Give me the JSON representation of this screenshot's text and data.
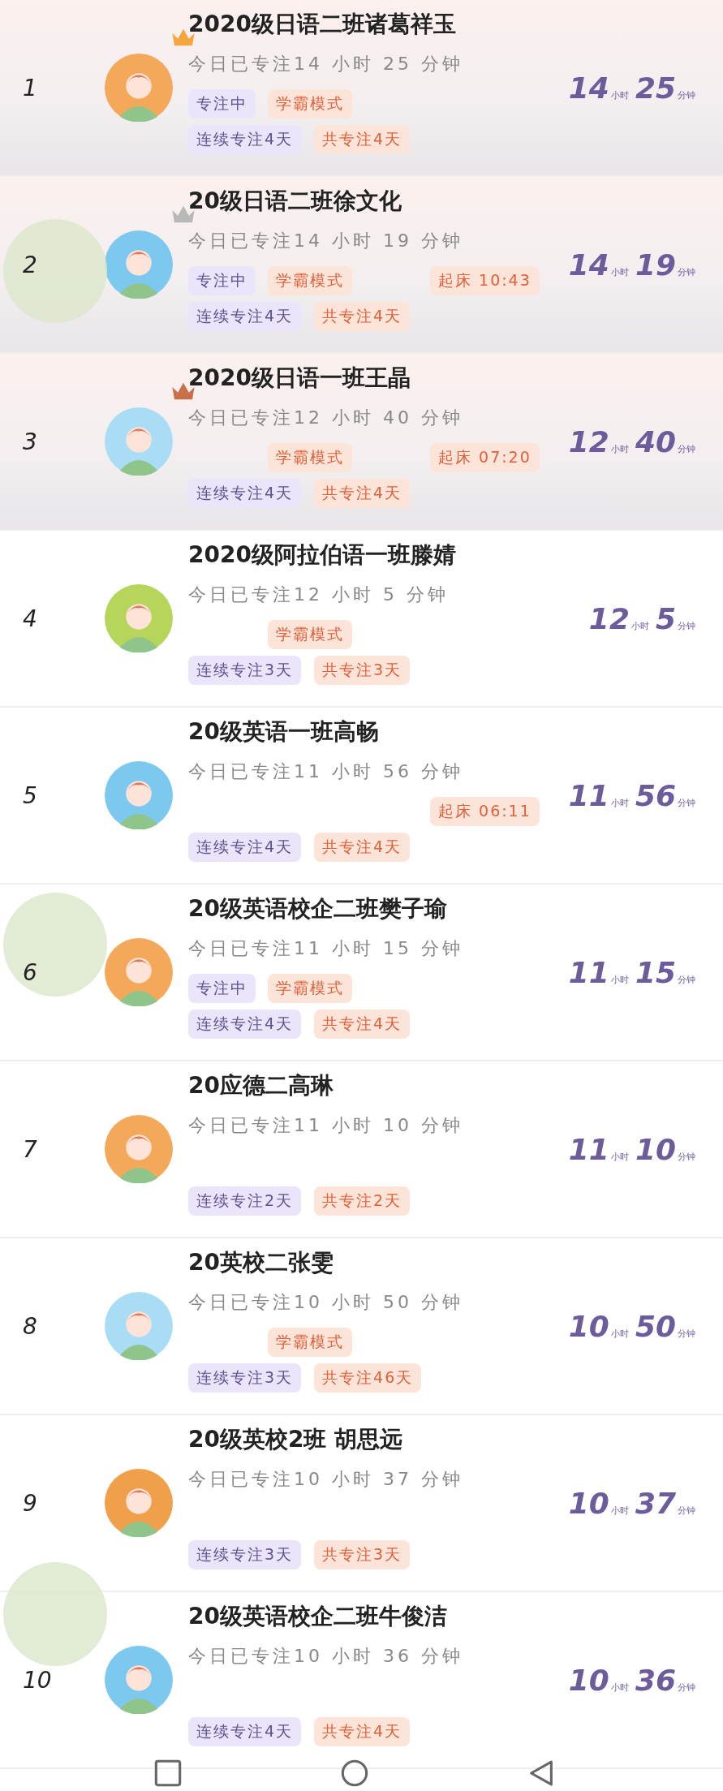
{
  "ranking": [
    {
      "rank": "1",
      "name": "2020级日语二班诸葛祥玉",
      "today": "今日已专注14 小时 25 分钟",
      "focusing": "专注中",
      "mode": "学霸模式",
      "streak": "连续专注4天",
      "total": "共专注4天",
      "hours": "14",
      "hours_unit": "小时",
      "minutes": "25",
      "minutes_unit": "分钟",
      "avatar": {
        "color": "#f4a85a"
      },
      "crown": {
        "color": "#f4a640"
      },
      "banner": true
    },
    {
      "rank": "2",
      "name": "20级日语二班徐文化",
      "today": "今日已专注14 小时 19 分钟",
      "focusing": "专注中",
      "mode": "学霸模式",
      "wake_up": "起床 10:43",
      "streak": "连续专注4天",
      "total": "共专注4天",
      "hours": "14",
      "hours_unit": "小时",
      "minutes": "19",
      "minutes_unit": "分钟",
      "avatar": {
        "color": "#7cc8ef"
      },
      "crown": {
        "color": "#b8b8b8"
      },
      "banner": true
    },
    {
      "rank": "3",
      "name": "2020级日语一班王晶",
      "today": "今日已专注12 小时 40 分钟",
      "mode": "学霸模式",
      "wake_up": "起床 07:20",
      "streak": "连续专注4天",
      "total": "共专注4天",
      "hours": "12",
      "hours_unit": "小时",
      "minutes": "40",
      "minutes_unit": "分钟",
      "avatar": {
        "color": "#a9dcf5"
      },
      "crown": {
        "color": "#c8704a"
      },
      "banner": true
    },
    {
      "rank": "4",
      "name": "2020级阿拉伯语一班滕婧",
      "today": "今日已专注12 小时 5 分钟",
      "mode": "学霸模式",
      "streak": "连续专注3天",
      "total": "共专注3天",
      "hours": "12",
      "hours_unit": "小时",
      "minutes": "5",
      "minutes_unit": "分钟",
      "avatar": {
        "color": "#b5d65a"
      },
      "banner": false
    },
    {
      "rank": "5",
      "name": "20级英语一班高畅",
      "today": "今日已专注11 小时 56 分钟",
      "wake_up": "起床 06:11",
      "streak": "连续专注4天",
      "total": "共专注4天",
      "hours": "11",
      "hours_unit": "小时",
      "minutes": "56",
      "minutes_unit": "分钟",
      "avatar": {
        "color": "#7cc8ef"
      },
      "banner": false
    },
    {
      "rank": "6",
      "name": "20级英语校企二班樊子瑜",
      "today": "今日已专注11 小时 15 分钟",
      "focusing": "专注中",
      "mode": "学霸模式",
      "streak": "连续专注4天",
      "total": "共专注4天",
      "hours": "11",
      "hours_unit": "小时",
      "minutes": "15",
      "minutes_unit": "分钟",
      "avatar": {
        "color": "#f4a85a"
      },
      "banner": false
    },
    {
      "rank": "7",
      "name": "20应德二高琳",
      "today": "今日已专注11 小时 10 分钟",
      "streak": "连续专注2天",
      "total": "共专注2天",
      "hours": "11",
      "hours_unit": "小时",
      "minutes": "10",
      "minutes_unit": "分钟",
      "avatar": {
        "color": "#f4a85a"
      },
      "banner": false
    },
    {
      "rank": "8",
      "name": "20英校二张雯",
      "today": "今日已专注10 小时 50 分钟",
      "mode": "学霸模式",
      "streak": "连续专注3天",
      "total": "共专注46天",
      "hours": "10",
      "hours_unit": "小时",
      "minutes": "50",
      "minutes_unit": "分钟",
      "avatar": {
        "color": "#a9dcf5"
      },
      "banner": false
    },
    {
      "rank": "9",
      "name": "20级英校2班 胡思远",
      "today": "今日已专注10 小时 37 分钟",
      "streak": "连续专注3天",
      "total": "共专注3天",
      "hours": "10",
      "hours_unit": "小时",
      "minutes": "37",
      "minutes_unit": "分钟",
      "avatar": {
        "color": "#f0a04a"
      },
      "banner": false
    },
    {
      "rank": "10",
      "name": "20级英语校企二班牛俊洁",
      "today": "今日已专注10 小时 36 分钟",
      "streak": "连续专注4天",
      "total": "共专注4天",
      "hours": "10",
      "hours_unit": "小时",
      "minutes": "36",
      "minutes_unit": "分钟",
      "avatar": {
        "color": "#7cc8ef"
      },
      "banner": false
    }
  ]
}
